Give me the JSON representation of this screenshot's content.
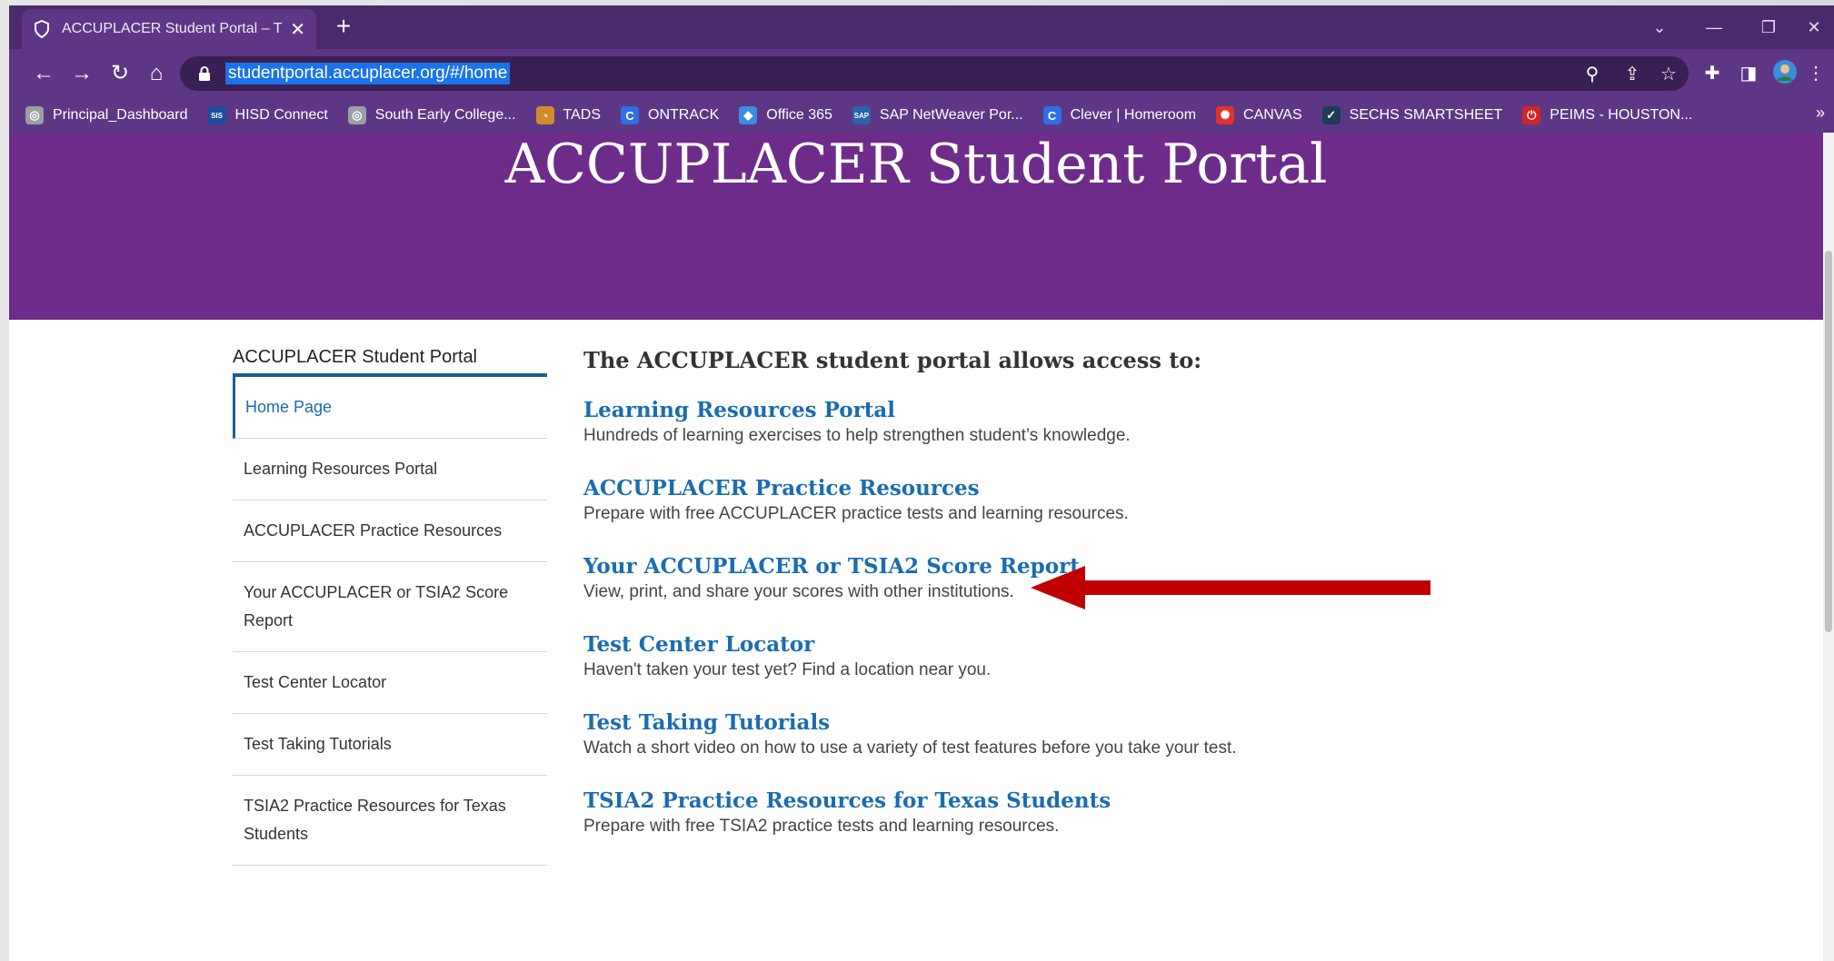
{
  "browser": {
    "tab_title": "ACCUPLACER Student Portal – The",
    "tab_close": "✕",
    "new_tab": "+",
    "url": "studentportal.accuplacer.org/#/home",
    "bookmarks": [
      {
        "label": "Principal_Dashboard",
        "icon": "globe-icon",
        "color": "#9aa0a6"
      },
      {
        "label": "HISD Connect",
        "icon": "sis-icon",
        "color": "#1e4e9c"
      },
      {
        "label": "South Early College...",
        "icon": "globe-icon",
        "color": "#9aa0a6"
      },
      {
        "label": "TADS",
        "icon": "tads-icon",
        "color": "#d08a2c"
      },
      {
        "label": "ONTRACK",
        "icon": "c-icon",
        "color": "#2f6fe4"
      },
      {
        "label": "Office 365",
        "icon": "office-icon",
        "color": "#3b8de0"
      },
      {
        "label": "SAP NetWeaver Por...",
        "icon": "sap-icon",
        "color": "#2b62a8"
      },
      {
        "label": "Clever | Homeroom",
        "icon": "c-icon",
        "color": "#2f6fe4"
      },
      {
        "label": "CANVAS",
        "icon": "canvas-icon",
        "color": "#e0322d"
      },
      {
        "label": "SECHS SMARTSHEET",
        "icon": "check-icon",
        "color": "#1f3b57"
      },
      {
        "label": "PEIMS - HOUSTON...",
        "icon": "power-icon",
        "color": "#d32424"
      }
    ],
    "more": "»"
  },
  "hero": {
    "title": "ACCUPLACER Student Portal"
  },
  "sidebar": {
    "heading": "ACCUPLACER Student Portal",
    "items": [
      {
        "label": "Home Page"
      },
      {
        "label": "Learning Resources Portal"
      },
      {
        "label": "ACCUPLACER Practice Resources"
      },
      {
        "label": "Your ACCUPLACER or TSIA2 Score Report"
      },
      {
        "label": "Test Center Locator"
      },
      {
        "label": "Test Taking Tutorials"
      },
      {
        "label": "TSIA2 Practice Resources for Texas Students"
      }
    ]
  },
  "content": {
    "intro": "The ACCUPLACER student portal allows access to:",
    "entries": [
      {
        "title": "Learning Resources Portal",
        "desc": "Hundreds of learning exercises to help strengthen student’s knowledge."
      },
      {
        "title": "ACCUPLACER Practice Resources",
        "desc": "Prepare with free ACCUPLACER practice tests and learning resources."
      },
      {
        "title": "Your ACCUPLACER or TSIA2 Score Report",
        "desc": "View, print, and share your scores with other institutions."
      },
      {
        "title": "Test Center Locator",
        "desc": "Haven't taken your test yet? Find a location near you."
      },
      {
        "title": "Test Taking Tutorials",
        "desc": "Watch a short video on how to use a variety of test features before you take your test."
      },
      {
        "title": "TSIA2 Practice Resources for Texas Students",
        "desc": "Prepare with free TSIA2 practice tests and learning resources."
      }
    ]
  },
  "colors": {
    "hero": "#6e2c8a",
    "chrome": "#5d3785",
    "link": "#1b6cb0",
    "arrow": "#c00000"
  }
}
